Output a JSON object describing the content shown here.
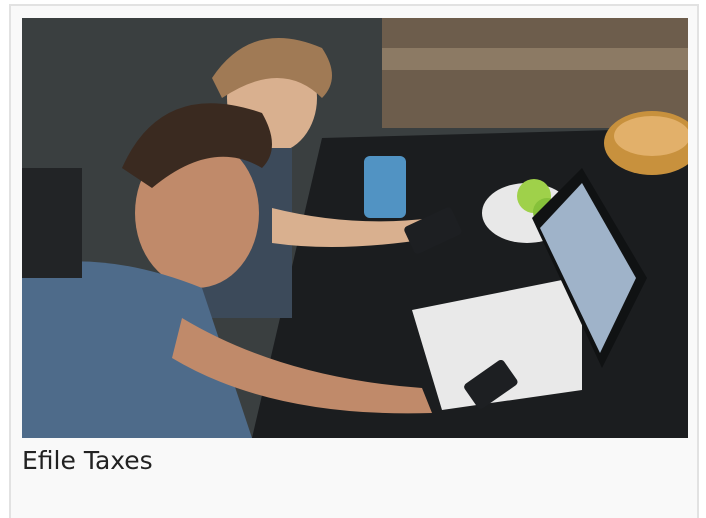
{
  "card": {
    "caption": "Efile Taxes"
  },
  "colors": {
    "card_background": "#f9f9f9",
    "card_border": "#e2e2e2",
    "caption_text": "#222222"
  }
}
